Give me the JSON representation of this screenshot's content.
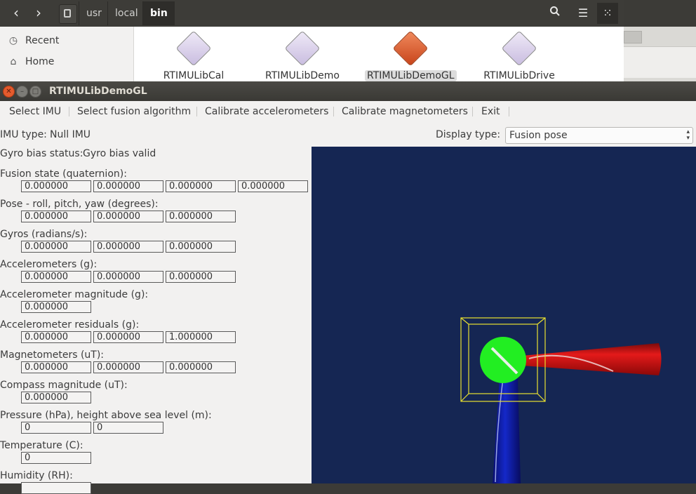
{
  "file_manager": {
    "breadcrumbs": [
      "usr",
      "local",
      "bin"
    ],
    "sidebar": [
      {
        "label": "Recent",
        "icon": "clock-icon"
      },
      {
        "label": "Home",
        "icon": "home-icon"
      }
    ],
    "files": [
      {
        "name": "RTIMULibCal",
        "selected": false
      },
      {
        "name": "RTIMULibDemo",
        "selected": false
      },
      {
        "name": "RTIMULibDemoGL",
        "selected": true
      },
      {
        "name": "RTIMULibDrive",
        "selected": false
      }
    ]
  },
  "window": {
    "title": "RTIMULibDemoGL",
    "menu": [
      "Select IMU",
      "Select fusion algorithm",
      "Calibrate accelerometers",
      "Calibrate magnetometers",
      "Exit"
    ]
  },
  "status": {
    "imu_type_label": "IMU type:",
    "imu_type_value": "Null IMU",
    "gyro_bias_label": "Gyro bias status:",
    "gyro_bias_value": "Gyro bias valid",
    "display_type_label": "Display type:",
    "display_type_value": "Fusion pose"
  },
  "fields": [
    {
      "label": "Fusion state (quaternion):",
      "values": [
        "0.000000",
        "0.000000",
        "0.000000",
        "0.000000"
      ]
    },
    {
      "label": "Pose - roll, pitch, yaw (degrees):",
      "values": [
        "0.000000",
        "0.000000",
        "0.000000"
      ]
    },
    {
      "label": "Gyros (radians/s):",
      "values": [
        "0.000000",
        "0.000000",
        "0.000000"
      ]
    },
    {
      "label": "Accelerometers (g):",
      "values": [
        "0.000000",
        "0.000000",
        "0.000000"
      ]
    },
    {
      "label": "Accelerometer magnitude (g):",
      "values": [
        "0.000000"
      ]
    },
    {
      "label": "Accelerometer residuals (g):",
      "values": [
        "0.000000",
        "0.000000",
        "1.000000"
      ]
    },
    {
      "label": "Magnetometers (uT):",
      "values": [
        "0.000000",
        "0.000000",
        "0.000000"
      ]
    },
    {
      "label": "Compass magnitude (uT):",
      "values": [
        "0.000000"
      ]
    },
    {
      "label": "Pressure (hPa), height above sea level (m):",
      "values": [
        "0",
        "0"
      ]
    },
    {
      "label": "Temperature (C):",
      "values": [
        "0"
      ]
    },
    {
      "label": "Humidity (RH):",
      "values": [
        ""
      ]
    }
  ],
  "colors": {
    "gl_background": "#152653",
    "pose_x_axis": "#d81818",
    "pose_y_axis": "#1020b8",
    "pose_sphere": "#22ee22",
    "pose_box": "#e8e030"
  }
}
